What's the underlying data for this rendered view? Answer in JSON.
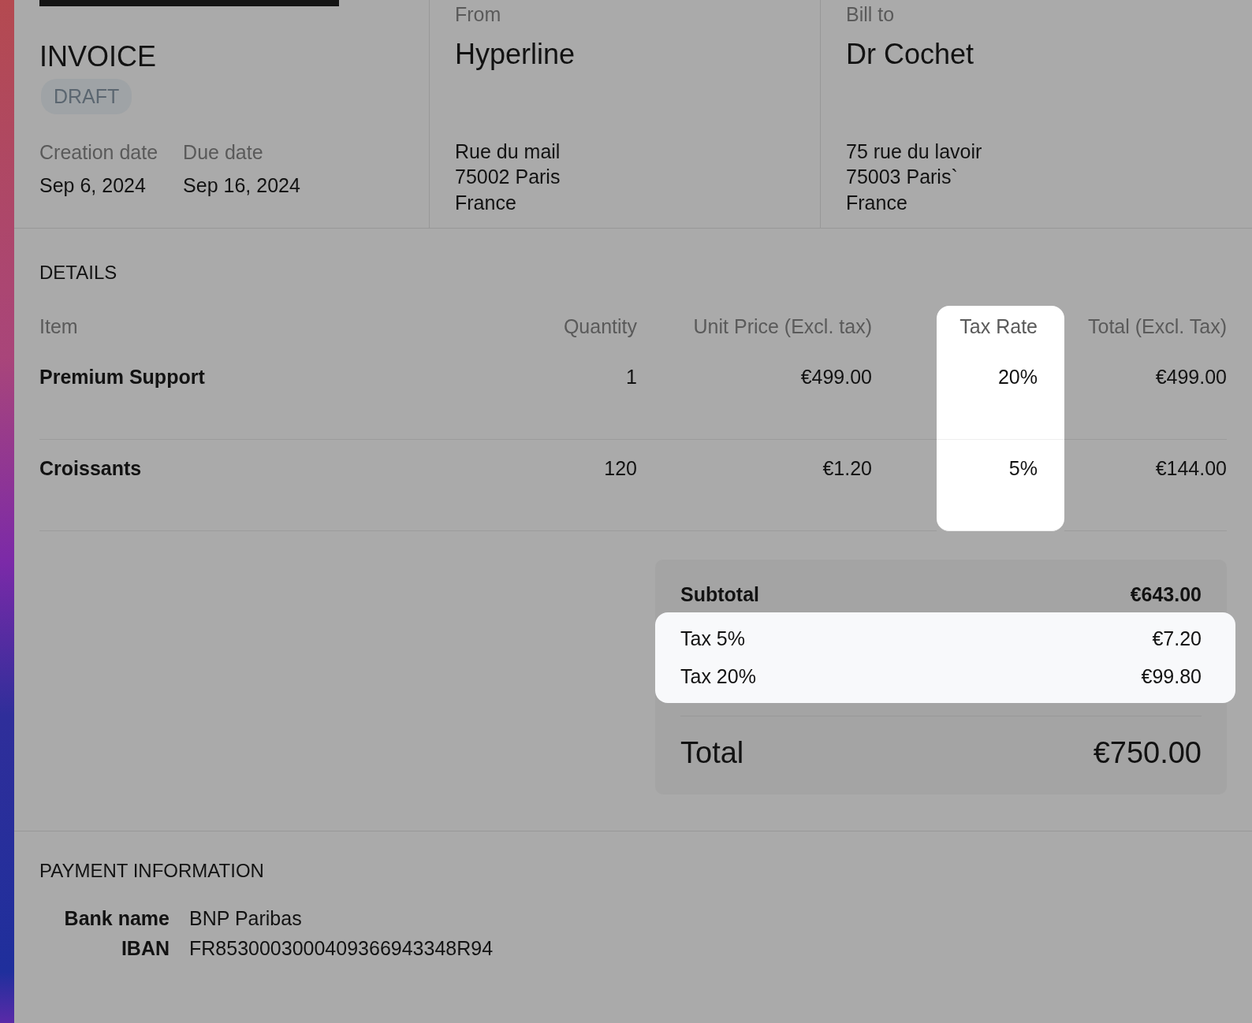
{
  "header": {
    "title": "INVOICE",
    "status": "DRAFT",
    "dates": [
      {
        "label": "Creation date",
        "value": "Sep 6, 2024"
      },
      {
        "label": "Due date",
        "value": "Sep 16, 2024"
      }
    ]
  },
  "parties": [
    {
      "label": "From",
      "name": "Hyperline",
      "address": [
        "Rue du mail",
        "75002 Paris",
        "France"
      ]
    },
    {
      "label": "Bill to",
      "name": "Dr Cochet",
      "address": [
        "75 rue du lavoir",
        "75003 Paris`",
        "France"
      ]
    }
  ],
  "details": {
    "title": "DETAILS",
    "columns": [
      {
        "label": "Item",
        "highlighted": false
      },
      {
        "label": "Quantity",
        "highlighted": false
      },
      {
        "label": "Unit Price (Excl. tax)",
        "highlighted": false
      },
      {
        "label": "Tax Rate",
        "highlighted": true
      },
      {
        "label": "Total (Excl. Tax)",
        "highlighted": false
      }
    ],
    "rows": [
      [
        "Premium Support",
        "1",
        "€499.00",
        "20%",
        "€499.00"
      ],
      [
        "Croissants",
        "120",
        "€1.20",
        "5%",
        "€144.00"
      ]
    ]
  },
  "totals": {
    "subtotal": {
      "label": "Subtotal",
      "value": "€643.00"
    },
    "taxes_highlighted": true,
    "taxes": [
      {
        "label": "Tax 5%",
        "value": "€7.20"
      },
      {
        "label": "Tax 20%",
        "value": "€99.80"
      }
    ],
    "total": {
      "label": "Total",
      "value": "€750.00"
    }
  },
  "payment": {
    "title": "PAYMENT INFORMATION",
    "fields": [
      {
        "label": "Bank name",
        "value": "BNP Paribas"
      },
      {
        "label": "IBAN",
        "value": "FR8530003000409366943348R94"
      }
    ]
  }
}
